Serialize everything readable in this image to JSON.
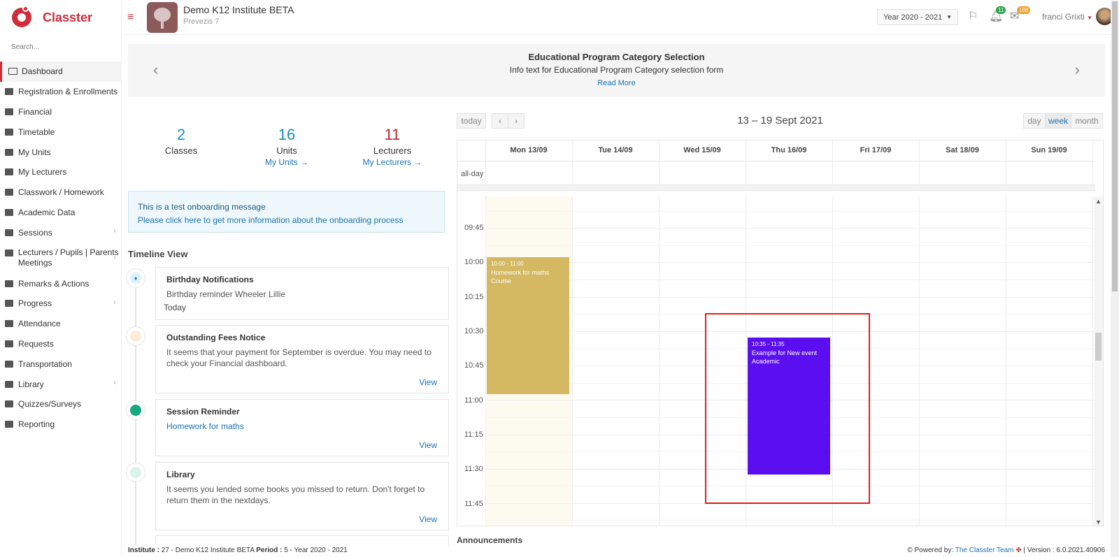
{
  "brand": {
    "name": "Classter"
  },
  "sidebar": {
    "search_placeholder": "Search...",
    "items": [
      {
        "label": "Dashboard"
      },
      {
        "label": "Registration & Enrollments"
      },
      {
        "label": "Financial"
      },
      {
        "label": "Timetable"
      },
      {
        "label": "My Units"
      },
      {
        "label": "My Lecturers"
      },
      {
        "label": "Classwork / Homework"
      },
      {
        "label": "Academic Data"
      },
      {
        "label": "Sessions"
      },
      {
        "label": "Lecturers / Pupils | Parents Meetings"
      },
      {
        "label": "Remarks & Actions"
      },
      {
        "label": "Progress"
      },
      {
        "label": "Attendance"
      },
      {
        "label": "Requests"
      },
      {
        "label": "Transportation"
      },
      {
        "label": "Library"
      },
      {
        "label": "Quizzes/Surveys"
      },
      {
        "label": "Reporting"
      }
    ]
  },
  "header": {
    "institute_name": "Demo K12 Institute BETA",
    "institute_sub": "Prevezis 7",
    "year": "Year 2020 - 2021",
    "notifications_count": "11",
    "messages_count": "108",
    "user_name": "franci Grixti"
  },
  "carousel": {
    "title": "Educational Program Category Selection",
    "text": "Info text for Educational Program Category selection form",
    "link": "Read More"
  },
  "stats": [
    {
      "value": "2",
      "label": "Classes",
      "link": "",
      "color": "#1a8fb8"
    },
    {
      "value": "16",
      "label": "Units",
      "link": "My Units →",
      "color": "#1a8fb8"
    },
    {
      "value": "11",
      "label": "Lecturers",
      "link": "My Lecturers →",
      "color": "#c0272d"
    }
  ],
  "onboarding": {
    "line1": "This is a test onboarding message",
    "line2": "Please click here to get more information about the onboarding process"
  },
  "timeline": {
    "title": "Timeline View",
    "cards": [
      {
        "title": "Birthday Notifications",
        "body": "Birthday reminder Wheeler Lillie",
        "extra": "Today",
        "view": ""
      },
      {
        "title": "Outstanding Fees Notice",
        "body": "It seems that your payment for September is overdue. You may need to check your Financial dashboard.",
        "view": "View"
      },
      {
        "title": "Session Reminder",
        "body": "Homework for maths",
        "view": "View"
      },
      {
        "title": "Library",
        "body": "It seems you lended some books you missed to return. Don't forget to return them in the nextdays.",
        "view": "View"
      }
    ]
  },
  "calendar": {
    "today_btn": "today",
    "range": "13 – 19 Sept 2021",
    "views": [
      "day",
      "week",
      "month"
    ],
    "active_view": "week",
    "allday_label": "all-day",
    "days": [
      "Mon 13/09",
      "Tue 14/09",
      "Wed 15/09",
      "Thu 16/09",
      "Fri 17/09",
      "Sat 18/09",
      "Sun 19/09"
    ],
    "times": [
      "09:45",
      "10:00",
      "10:15",
      "10:30",
      "10:45",
      "11:00",
      "11:15",
      "11:30",
      "11:45"
    ],
    "events": [
      {
        "time": "10:00 - 11:00",
        "title": "Homework for maths Course",
        "color": "#d4b862"
      },
      {
        "time": "10:35 - 11:35",
        "title": "Example for New event Academic",
        "color": "#5b0ff0"
      }
    ]
  },
  "announcements_label": "Announcements",
  "footer": {
    "institute_label": "Institute :",
    "institute_value": "27 - Demo K12 Institute BETA",
    "period_label": "Period :",
    "period_value": "5 - Year 2020 - 2021",
    "powered_by": "Powered by:",
    "team": "The Classter Team",
    "version": "| Version : 6.0.2021.40906"
  }
}
